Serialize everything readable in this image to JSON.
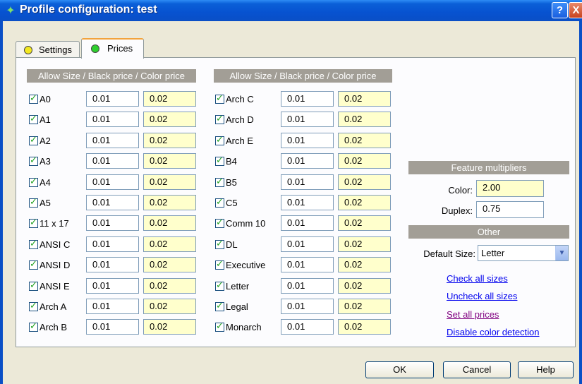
{
  "window": {
    "title": "Profile configuration: test",
    "help_label": "?",
    "close_label": "X"
  },
  "tabs": [
    {
      "label": "Settings",
      "active": false
    },
    {
      "label": "Prices",
      "active": true
    }
  ],
  "column_header": "Allow Size / Black price / Color price",
  "left_sizes": [
    {
      "name": "A0",
      "checked": true,
      "black": "0.01",
      "color": "0.02"
    },
    {
      "name": "A1",
      "checked": true,
      "black": "0.01",
      "color": "0.02"
    },
    {
      "name": "A2",
      "checked": true,
      "black": "0.01",
      "color": "0.02"
    },
    {
      "name": "A3",
      "checked": true,
      "black": "0.01",
      "color": "0.02"
    },
    {
      "name": "A4",
      "checked": true,
      "black": "0.01",
      "color": "0.02"
    },
    {
      "name": "A5",
      "checked": true,
      "black": "0.01",
      "color": "0.02"
    },
    {
      "name": "11 x 17",
      "checked": true,
      "black": "0.01",
      "color": "0.02"
    },
    {
      "name": "ANSI C",
      "checked": true,
      "black": "0.01",
      "color": "0.02"
    },
    {
      "name": "ANSI D",
      "checked": true,
      "black": "0.01",
      "color": "0.02"
    },
    {
      "name": "ANSI E",
      "checked": true,
      "black": "0.01",
      "color": "0.02"
    },
    {
      "name": "Arch A",
      "checked": true,
      "black": "0.01",
      "color": "0.02"
    },
    {
      "name": "Arch B",
      "checked": true,
      "black": "0.01",
      "color": "0.02"
    }
  ],
  "right_sizes": [
    {
      "name": "Arch C",
      "checked": true,
      "black": "0.01",
      "color": "0.02"
    },
    {
      "name": "Arch D",
      "checked": true,
      "black": "0.01",
      "color": "0.02"
    },
    {
      "name": "Arch E",
      "checked": true,
      "black": "0.01",
      "color": "0.02"
    },
    {
      "name": "B4",
      "checked": true,
      "black": "0.01",
      "color": "0.02"
    },
    {
      "name": "B5",
      "checked": true,
      "black": "0.01",
      "color": "0.02"
    },
    {
      "name": "C5",
      "checked": true,
      "black": "0.01",
      "color": "0.02"
    },
    {
      "name": "Comm 10",
      "checked": true,
      "black": "0.01",
      "color": "0.02"
    },
    {
      "name": "DL",
      "checked": true,
      "black": "0.01",
      "color": "0.02"
    },
    {
      "name": "Executive",
      "checked": true,
      "black": "0.01",
      "color": "0.02"
    },
    {
      "name": "Letter",
      "checked": true,
      "black": "0.01",
      "color": "0.02"
    },
    {
      "name": "Legal",
      "checked": true,
      "black": "0.01",
      "color": "0.02"
    },
    {
      "name": "Monarch",
      "checked": true,
      "black": "0.01",
      "color": "0.02"
    }
  ],
  "feature_multipliers": {
    "header": "Feature multipliers",
    "color_label": "Color:",
    "color_value": "2.00",
    "duplex_label": "Duplex:",
    "duplex_value": "0.75"
  },
  "other": {
    "header": "Other",
    "default_size_label": "Default Size:",
    "default_size_value": "Letter"
  },
  "links": {
    "check_all": "Check all sizes",
    "uncheck_all": "Uncheck all sizes",
    "set_all_prices": "Set all prices",
    "disable_color": "Disable color detection"
  },
  "buttons": {
    "ok": "OK",
    "cancel": "Cancel",
    "help": "Help"
  },
  "colors": {
    "title_bar": "#0752d0",
    "header_bg": "#a29e96",
    "color_price_bg": "#ffffcc",
    "check": "#21a121"
  }
}
